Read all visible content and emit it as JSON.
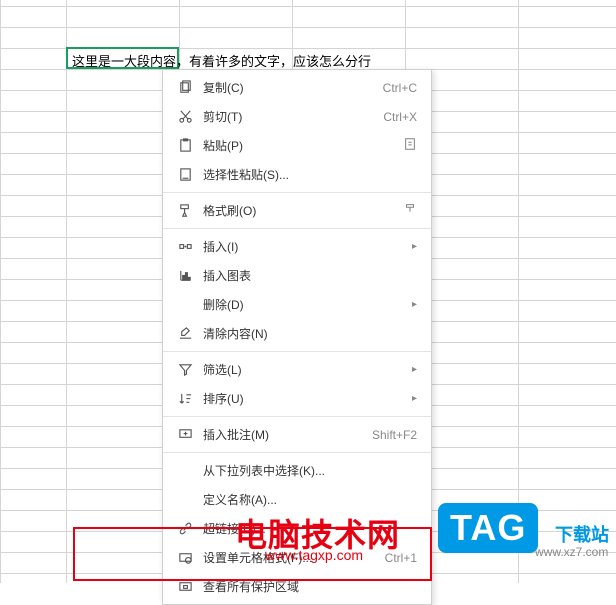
{
  "cell_text": "这里是一大段内容，有着许多的文字，应该怎么分行",
  "menu": {
    "copy": {
      "label": "复制(C)",
      "shortcut": "Ctrl+C"
    },
    "cut": {
      "label": "剪切(T)",
      "shortcut": "Ctrl+X"
    },
    "paste": {
      "label": "粘贴(P)"
    },
    "paste_special": {
      "label": "选择性粘贴(S)..."
    },
    "format_painter": {
      "label": "格式刷(O)"
    },
    "insert": {
      "label": "插入(I)"
    },
    "insert_chart": {
      "label": "插入图表"
    },
    "delete": {
      "label": "删除(D)"
    },
    "clear": {
      "label": "清除内容(N)"
    },
    "filter": {
      "label": "筛选(L)"
    },
    "sort": {
      "label": "排序(U)"
    },
    "insert_comment": {
      "label": "插入批注(M)",
      "shortcut": "Shift+F2"
    },
    "pick_from_list": {
      "label": "从下拉列表中选择(K)..."
    },
    "define_name": {
      "label": "定义名称(A)..."
    },
    "hyperlink": {
      "label": "超链接(H)..."
    },
    "format_cells": {
      "label": "设置单元格格式(F)...",
      "shortcut": "Ctrl+1"
    },
    "view_protected": {
      "label": "查看所有保护区域"
    }
  },
  "watermark": {
    "title": "电脑技术网",
    "url": "www.tagxp.com"
  },
  "tag": {
    "text": "TAG",
    "sub": "下载站",
    "url": "www.xz7.com"
  }
}
